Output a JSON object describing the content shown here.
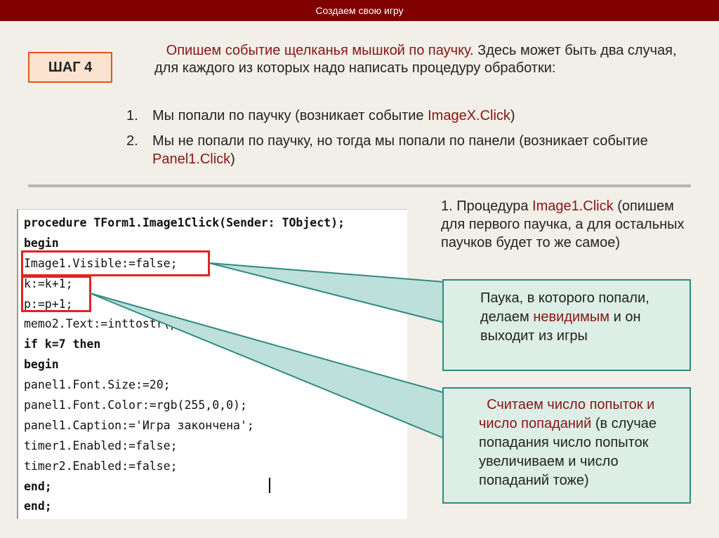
{
  "header": {
    "title": "Создаем свою игру"
  },
  "step": {
    "label": "ШАГ 4"
  },
  "intro": {
    "highlight": "Опишем событие щелканья мышкой по паучку",
    "rest": ". Здесь может быть два случая, для каждого из которых надо написать процедуру обработки:"
  },
  "cases": [
    {
      "num": "1.",
      "text": "Мы попали по паучку (возникает событие ",
      "event": "ImageX.Click",
      "tail": ")"
    },
    {
      "num": "2.",
      "text": "Мы не попали по паучку, но тогда мы попали по панели (возникает событие ",
      "event": "Panel1.Click",
      "tail": ")"
    }
  ],
  "code": {
    "lines": [
      "procedure TForm1.Image1Click(Sender: TObject);",
      "begin",
      "Image1.Visible:=false;",
      "k:=k+1;",
      "p:=p+1;",
      "memo2.Text:=inttostr(p);",
      "if k=7 then",
      "begin",
      "panel1.Font.Size:=20;",
      "panel1.Font.Color:=rgb(255,0,0);",
      "panel1.Caption:='Игра закончена';",
      "timer1.Enabled:=false;",
      "timer2.Enabled:=false;",
      "end;",
      "end;"
    ]
  },
  "procedure_note": {
    "prefix": "1. Процедура ",
    "name": "Image1.Click",
    "rest": " (опишем для первого паучка, а для остальных паучков будет то же самое)"
  },
  "callout1": {
    "part1": "Паука, в которого попали, делаем ",
    "highlight": "невидимым",
    "part2": "  и он выходит из игры"
  },
  "callout2": {
    "highlight": "Считаем число попыток и число попаданий",
    "rest": " (в случае попадания число попыток увеличиваем и число попаданий тоже)"
  },
  "colors": {
    "header_bg": "#800000",
    "accent_red": "#8a1414",
    "badge_border": "#e0561e",
    "callout_border": "#2f8a7f",
    "callout_bg": "#dceee6",
    "highlight_box": "#e32222"
  }
}
